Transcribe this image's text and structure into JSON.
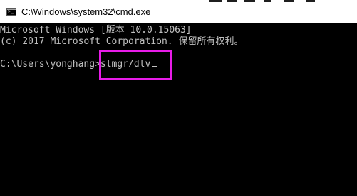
{
  "window": {
    "title": "C:\\Windows\\system32\\cmd.exe"
  },
  "console": {
    "lines": [
      "Microsoft Windows [版本 10.0.15063]",
      "(c) 2017 Microsoft Corporation. 保留所有权利。"
    ],
    "prompt": "C:\\Users\\yonghang>",
    "command": "slmgr/dlv"
  },
  "colors": {
    "console_background": "#000000",
    "console_text": "#c0c0c0",
    "highlight": "#e81ce8"
  },
  "icons": {
    "window_icon": "cmd-icon",
    "cursor": "text-cursor"
  }
}
